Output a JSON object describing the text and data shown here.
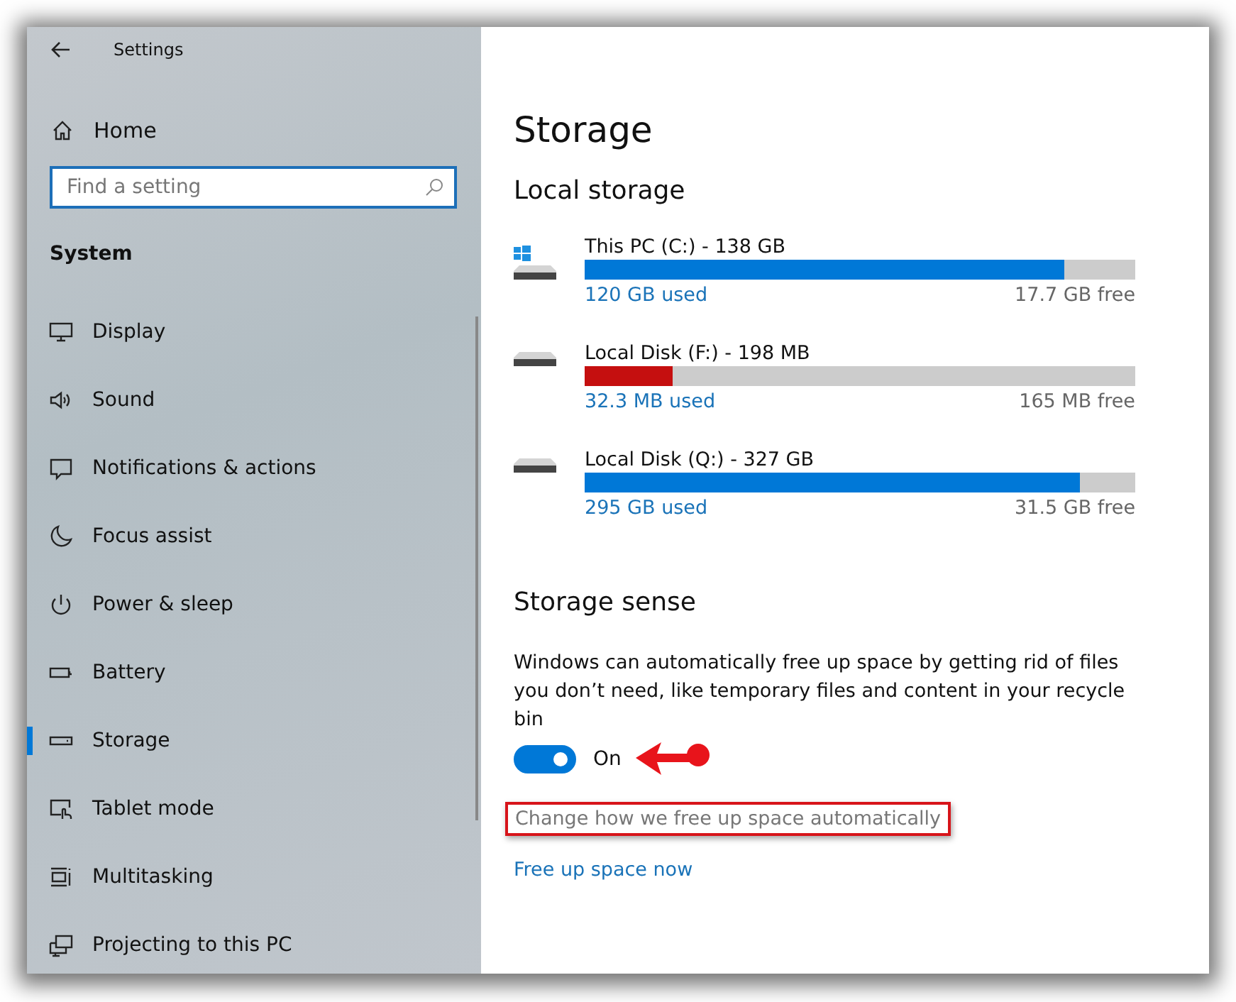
{
  "window": {
    "title": "Settings"
  },
  "sidebar": {
    "home": "Home",
    "search": {
      "placeholder": "Find a setting"
    },
    "section": "System",
    "items": [
      {
        "label": "Display",
        "kind": "display",
        "selected": false
      },
      {
        "label": "Sound",
        "kind": "sound",
        "selected": false
      },
      {
        "label": "Notifications & actions",
        "kind": "notifications",
        "selected": false
      },
      {
        "label": "Focus assist",
        "kind": "moon",
        "selected": false
      },
      {
        "label": "Power & sleep",
        "kind": "power",
        "selected": false
      },
      {
        "label": "Battery",
        "kind": "battery",
        "selected": false
      },
      {
        "label": "Storage",
        "kind": "storage",
        "selected": true
      },
      {
        "label": "Tablet mode",
        "kind": "tablet",
        "selected": false
      },
      {
        "label": "Multitasking",
        "kind": "multitasking",
        "selected": false
      },
      {
        "label": "Projecting to this PC",
        "kind": "projecting",
        "selected": false
      }
    ]
  },
  "content": {
    "title": "Storage",
    "local_storage": {
      "heading": "Local storage",
      "drives": [
        {
          "name": "This PC (C:) - 138 GB",
          "kind": "system",
          "level": 0.87,
          "color": "#0078d7",
          "used": "120 GB used",
          "free": "17.7 GB free"
        },
        {
          "name": "Local Disk (F:) - 198 MB",
          "kind": "disk",
          "level": 0.16,
          "color": "#c50f0f",
          "used": "32.3 MB used",
          "free": "165 MB free"
        },
        {
          "name": "Local Disk (Q:) - 327 GB",
          "kind": "disk",
          "level": 0.9,
          "color": "#0078d7",
          "used": "295 GB used",
          "free": "31.5 GB free"
        }
      ]
    },
    "storage_sense": {
      "heading": "Storage sense",
      "description": "Windows can automatically free up space by getting rid of files you don’t need, like temporary files and content in your recycle bin",
      "toggle": {
        "on": true,
        "label": "On",
        "pointed": true
      },
      "change_link": {
        "label": "Change how we free up space automatically",
        "highlighted": true
      },
      "free_link": "Free up space now"
    }
  }
}
